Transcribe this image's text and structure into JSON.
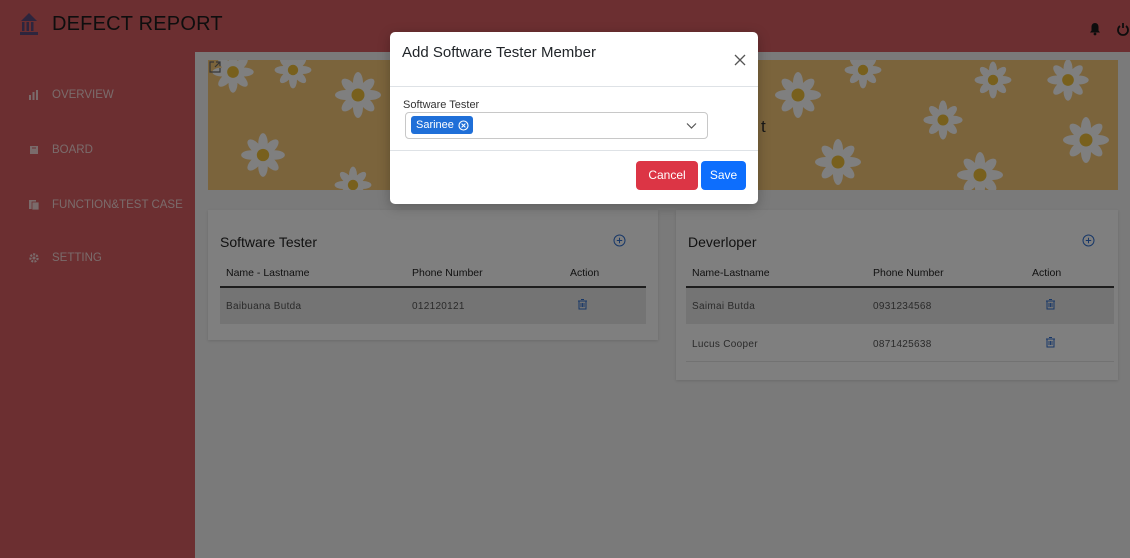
{
  "app": {
    "title": "DEFECT REPORT"
  },
  "sidebar": {
    "items": [
      {
        "label": "OVERVIEW",
        "icon": "bar-chart-icon"
      },
      {
        "label": "BOARD",
        "icon": "board-icon"
      },
      {
        "label": "FUNCTION&TEST CASE",
        "icon": "document-icon"
      },
      {
        "label": "SETTING",
        "icon": "gear-icon"
      }
    ]
  },
  "banner": {
    "title_partial": "t"
  },
  "software_tester_card": {
    "title": "Software Tester",
    "columns": [
      "Name - Lastname",
      "Phone Number",
      "Action"
    ],
    "rows": [
      {
        "name": "Baibuana  Butda",
        "phone": "012120121"
      }
    ]
  },
  "developer_card": {
    "title": "Deverloper",
    "columns": [
      "Name-Lastname",
      "Phone Number",
      "Action"
    ],
    "rows": [
      {
        "name": "Saimai  Butda",
        "phone": "0931234568"
      },
      {
        "name": "Lucus  Cooper",
        "phone": "0871425638"
      }
    ]
  },
  "modal": {
    "title": "Add Software Tester Member",
    "field_label": "Software Tester",
    "selected": [
      "Sarinee"
    ],
    "cancel_label": "Cancel",
    "save_label": "Save"
  },
  "colors": {
    "sidebar": "#d85f63",
    "banner": "#f7c978",
    "primary": "#0d6efd",
    "danger": "#dc3545",
    "chip": "#1f6fd8"
  }
}
